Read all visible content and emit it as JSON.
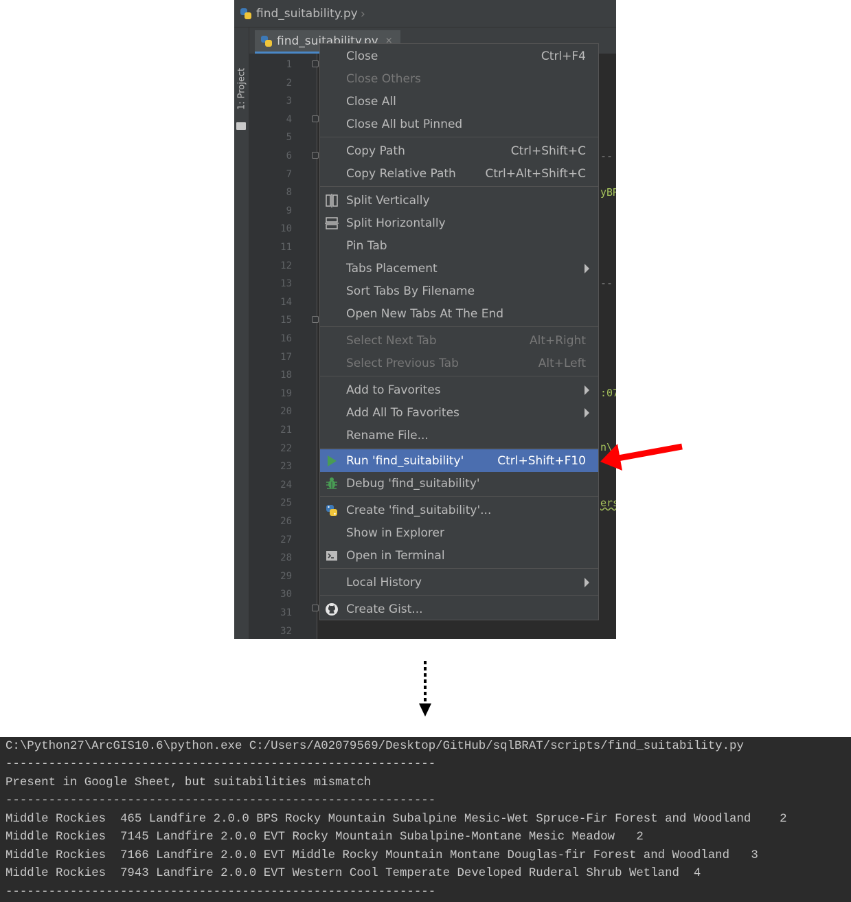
{
  "breadcrumb": {
    "file": "find_suitability.py"
  },
  "tool_window": {
    "label": "1: Project"
  },
  "editor": {
    "tab_label": "find_suitability.py",
    "tab_close": "×",
    "line_numbers": [
      "1",
      "2",
      "3",
      "4",
      "5",
      "6",
      "7",
      "8",
      "9",
      "10",
      "11",
      "12",
      "13",
      "14",
      "15",
      "16",
      "17",
      "18",
      "19",
      "20",
      "21",
      "22",
      "23",
      "24",
      "25",
      "26",
      "27",
      "28",
      "29",
      "30",
      "31",
      "32"
    ],
    "visible_code_fragments": [
      "--",
      "yBR",
      "--",
      ":07",
      "n\\",
      "ers"
    ]
  },
  "context_menu": {
    "items": [
      {
        "label": "Close",
        "shortcut": "Ctrl+F4"
      },
      {
        "label": "Close Others",
        "shortcut": ""
      },
      {
        "label": "Close All",
        "shortcut": ""
      },
      {
        "label": "Close All but Pinned",
        "shortcut": ""
      },
      {
        "label": "Copy Path",
        "shortcut": "Ctrl+Shift+C"
      },
      {
        "label": "Copy Relative Path",
        "shortcut": "Ctrl+Alt+Shift+C"
      },
      {
        "label": "Split Vertically",
        "shortcut": ""
      },
      {
        "label": "Split Horizontally",
        "shortcut": ""
      },
      {
        "label": "Pin Tab",
        "shortcut": ""
      },
      {
        "label": "Tabs Placement",
        "shortcut": ""
      },
      {
        "label": "Sort Tabs By Filename",
        "shortcut": ""
      },
      {
        "label": "Open New Tabs At The End",
        "shortcut": ""
      },
      {
        "label": "Select Next Tab",
        "shortcut": "Alt+Right"
      },
      {
        "label": "Select Previous Tab",
        "shortcut": "Alt+Left"
      },
      {
        "label": "Add to Favorites",
        "shortcut": ""
      },
      {
        "label": "Add All To Favorites",
        "shortcut": ""
      },
      {
        "label": "Rename File...",
        "shortcut": ""
      },
      {
        "label": "Run 'find_suitability'",
        "shortcut": "Ctrl+Shift+F10"
      },
      {
        "label": "Debug 'find_suitability'",
        "shortcut": ""
      },
      {
        "label": "Create 'find_suitability'...",
        "shortcut": ""
      },
      {
        "label": "Show in Explorer",
        "shortcut": ""
      },
      {
        "label": "Open in Terminal",
        "shortcut": ""
      },
      {
        "label": "Local History",
        "shortcut": ""
      },
      {
        "label": "Create Gist...",
        "shortcut": ""
      }
    ]
  },
  "icons": {
    "split_vertically": "split-vertical-icon",
    "split_horizontally": "split-horizontal-icon",
    "run": "run-icon",
    "debug": "debug-bug-icon",
    "create_config": "python-icon",
    "terminal": "terminal-icon",
    "gist": "github-icon"
  },
  "colors": {
    "menu_selected": "#4b6eaf",
    "run_icon": "#499c54",
    "red_arrow": "#ff0000",
    "code_green": "#a5c25c"
  },
  "console": {
    "lines": [
      "C:\\Python27\\ArcGIS10.6\\python.exe C:/Users/A02079569/Desktop/GitHub/sqlBRAT/scripts/find_suitability.py",
      "------------------------------------------------------------",
      "Present in Google Sheet, but suitabilities mismatch",
      "------------------------------------------------------------",
      "Middle Rockies  465 Landfire 2.0.0 BPS Rocky Mountain Subalpine Mesic-Wet Spruce-Fir Forest and Woodland    2",
      "Middle Rockies  7145 Landfire 2.0.0 EVT Rocky Mountain Subalpine-Montane Mesic Meadow   2",
      "Middle Rockies  7166 Landfire 2.0.0 EVT Middle Rocky Mountain Montane Douglas-fir Forest and Woodland   3",
      "Middle Rockies  7943 Landfire 2.0.0 EVT Western Cool Temperate Developed Ruderal Shrub Wetland  4",
      "------------------------------------------------------------"
    ]
  }
}
